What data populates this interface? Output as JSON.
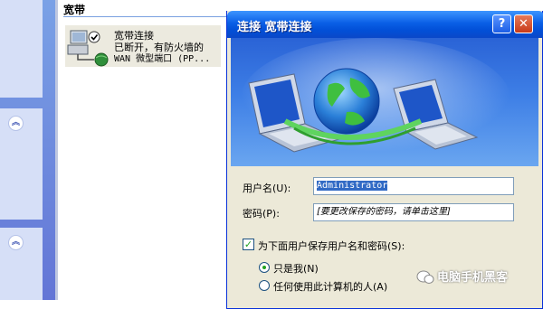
{
  "explorer": {
    "group_header": "宽带",
    "connection": {
      "name": "宽带连接",
      "status": "已断开，有防火墙的",
      "device": "WAN 微型端口 (PP..."
    },
    "collapse_glyph": "︽"
  },
  "dialog": {
    "title": "连接 宽带连接",
    "help_glyph": "?",
    "close_glyph": "✕",
    "username_label": "用户名(U):",
    "username_value": "Administrator",
    "password_label": "密码(P):",
    "password_placeholder": "[要更改保存的密码，请单击这里]",
    "save_checkbox_label": "为下面用户保存用户名和密码(S):",
    "save_checked": true,
    "radio_options": [
      {
        "label": "只是我(N)",
        "selected": true
      },
      {
        "label": "任何使用此计算机的人(A)",
        "selected": false
      }
    ]
  },
  "watermark": "电脑手机黑客",
  "colors": {
    "titlebar": "#0a5fe6",
    "dialog_bg": "#ece9d8",
    "selection": "#316ac5",
    "task_pane": "#6375d6"
  }
}
